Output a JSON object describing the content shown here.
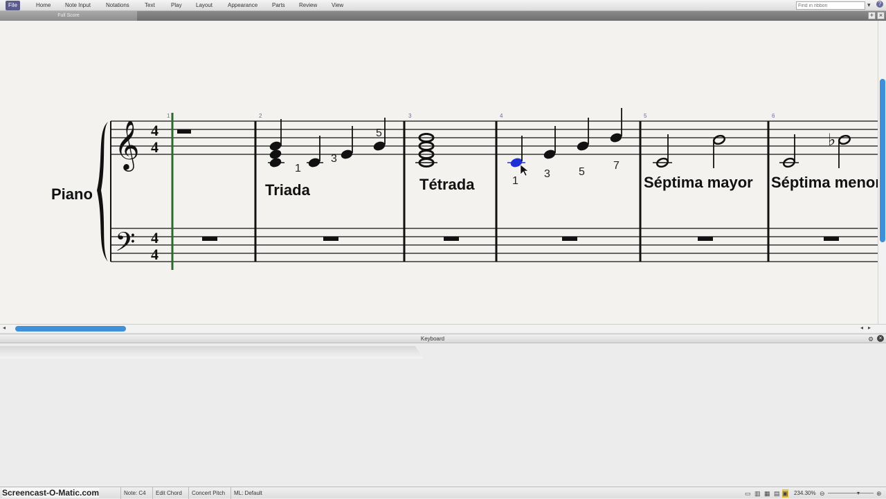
{
  "menu": {
    "items": [
      "File",
      "Home",
      "Note Input",
      "Notations",
      "Text",
      "Play",
      "Layout",
      "Appearance",
      "Parts",
      "Review",
      "View"
    ],
    "active": "File",
    "find_placeholder": "Find in ribbon"
  },
  "tabs": {
    "full_score": "Full Score"
  },
  "score": {
    "instrument": "Piano",
    "time_signature": {
      "top": "4",
      "bottom": "4"
    },
    "measure_numbers": [
      "1",
      "2",
      "3",
      "4",
      "5",
      "6"
    ],
    "labels": {
      "triada": "Triada",
      "tetrada": "Tétrada",
      "septima_mayor": "Séptima mayor",
      "septima_menor": "Séptima menor"
    },
    "fingering_m2": [
      "1",
      "3",
      "5"
    ],
    "fingering_m4": [
      "1",
      "3",
      "5",
      "7"
    ],
    "highlight_color": "#1f2fd6"
  },
  "keyboard": {
    "title": "Keyboard"
  },
  "status": {
    "watermark": "Screencast-O-Matic.com",
    "note": "Note: C4",
    "edit_chord": "Edit Chord",
    "concert_pitch": "Concert Pitch",
    "ml": "ML: Default",
    "zoom": "234.30%"
  },
  "colors": {
    "accent": "#3f8fd9",
    "playback_line": "#2d6b2d",
    "paper": "#f3f2ee"
  }
}
